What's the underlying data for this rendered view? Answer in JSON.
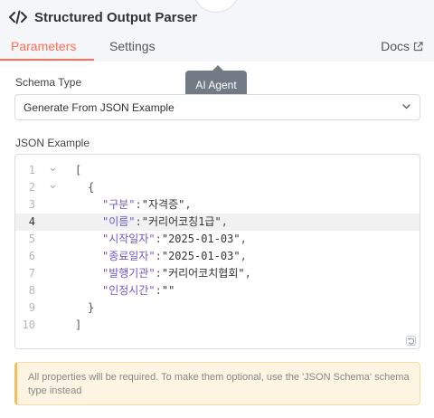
{
  "panel": {
    "title": "Structured Output Parser"
  },
  "tabs": [
    {
      "label": "Parameters",
      "active": true
    },
    {
      "label": "Settings",
      "active": false
    }
  ],
  "docs_link": {
    "label": "Docs",
    "icon": "external-link-icon"
  },
  "tooltip": {
    "text": "AI Agent"
  },
  "schema_type": {
    "label": "Schema Type",
    "value": "Generate From JSON Example"
  },
  "json_example": {
    "label": "JSON Example",
    "active_line": 4,
    "lines": [
      {
        "num": "1",
        "text": "["
      },
      {
        "num": "2",
        "text": "{"
      },
      {
        "num": "3",
        "key": "\"구분\"",
        "sep": ":",
        "value": "\"자격증\"",
        "end": ","
      },
      {
        "num": "4",
        "key": "\"이름\"",
        "sep": ":",
        "value": "\"커리어코칭1급\"",
        "end": ","
      },
      {
        "num": "5",
        "key": "\"시작일자\"",
        "sep": ":",
        "value": "\"2025-01-03\"",
        "end": ","
      },
      {
        "num": "6",
        "key": "\"종료일자\"",
        "sep": ":",
        "value": "\"2025-01-03\"",
        "end": ","
      },
      {
        "num": "7",
        "key": "\"발행기관\"",
        "sep": ":",
        "value": "\"커리어코치협회\"",
        "end": ","
      },
      {
        "num": "8",
        "key": "\"인정시간\"",
        "sep": ":",
        "value": "\"\"",
        "end": ""
      },
      {
        "num": "9",
        "text": "}"
      },
      {
        "num": "10",
        "text": "]"
      }
    ]
  },
  "notice": {
    "text": "All properties will be required. To make them optional, use the 'JSON Schema' schema type instead"
  },
  "colors": {
    "accent": "#ff6d5a",
    "tooltip": "#727a85",
    "notice_bg": "#fdf4e2",
    "notice_border": "#f1be5e"
  }
}
